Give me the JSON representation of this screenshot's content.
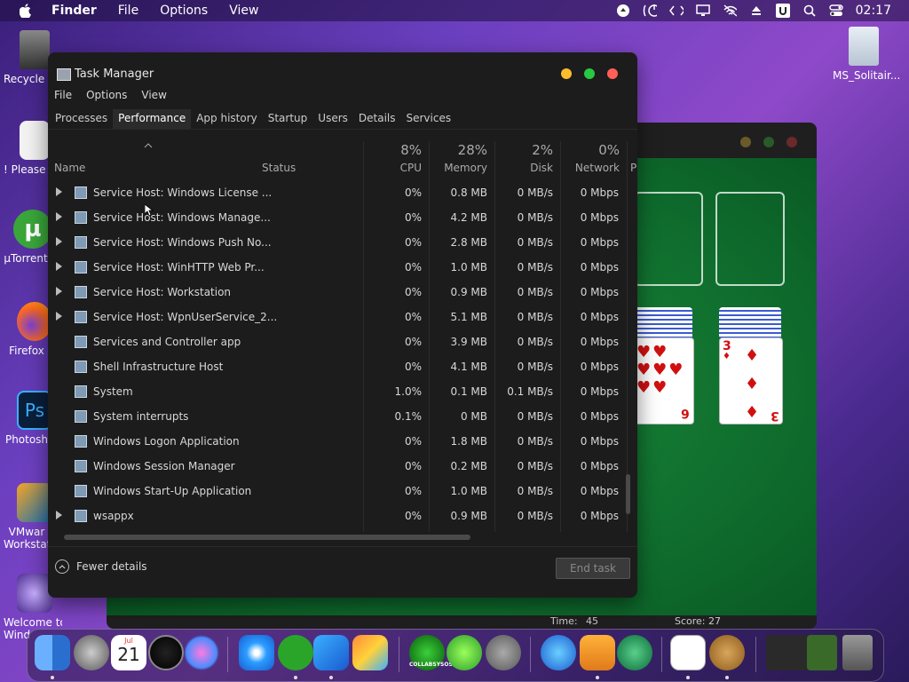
{
  "menubar": {
    "app": "Finder",
    "items": [
      "File",
      "Options",
      "View"
    ],
    "clock": "02:17"
  },
  "desktop": {
    "icons": [
      {
        "label": "Recycle Bin"
      },
      {
        "label": "! Please Re"
      },
      {
        "label": "µTorrent"
      },
      {
        "label": "Firefox"
      },
      {
        "label": "Photosh"
      },
      {
        "label": "VMwar\nWorkstat"
      },
      {
        "label": "Welcome to\nWind"
      }
    ],
    "right_icon": {
      "label": "MS_Solitair..."
    }
  },
  "solitaire": {
    "time_label": "Time:",
    "time_value": "45",
    "score_label": "Score:",
    "score_value": "27",
    "cards": [
      {
        "rank": "6",
        "suit": "♥"
      },
      {
        "rank": "3",
        "suit": "♦"
      }
    ]
  },
  "task_manager": {
    "title": "Task Manager",
    "menu": [
      "File",
      "Options",
      "View"
    ],
    "tabs": [
      "Processes",
      "Performance",
      "App history",
      "Startup",
      "Users",
      "Details",
      "Services"
    ],
    "active_tab": "Performance",
    "columns": {
      "name": "Name",
      "status": "Status",
      "cpu": {
        "pct": "8%",
        "label": "CPU"
      },
      "memory": {
        "pct": "28%",
        "label": "Memory"
      },
      "disk": {
        "pct": "2%",
        "label": "Disk"
      },
      "network": {
        "pct": "0%",
        "label": "Network"
      },
      "next": "P"
    },
    "rows": [
      {
        "name": "Service Host: Windows License ...",
        "cpu": "0%",
        "memory": "0.8 MB",
        "disk": "0 MB/s",
        "network": "0 Mbps",
        "expandable": true
      },
      {
        "name": "Service Host: Windows Manage...",
        "cpu": "0%",
        "memory": "4.2 MB",
        "disk": "0 MB/s",
        "network": "0 Mbps",
        "expandable": true
      },
      {
        "name": "Service Host: Windows Push No...",
        "cpu": "0%",
        "memory": "2.8 MB",
        "disk": "0 MB/s",
        "network": "0 Mbps",
        "expandable": true
      },
      {
        "name": "Service Host: WinHTTP Web Pr...",
        "cpu": "0%",
        "memory": "1.0 MB",
        "disk": "0 MB/s",
        "network": "0 Mbps",
        "expandable": true
      },
      {
        "name": "Service Host: Workstation",
        "cpu": "0%",
        "memory": "0.9 MB",
        "disk": "0 MB/s",
        "network": "0 Mbps",
        "expandable": true
      },
      {
        "name": "Service Host: WpnUserService_2...",
        "cpu": "0%",
        "memory": "5.1 MB",
        "disk": "0 MB/s",
        "network": "0 Mbps",
        "expandable": true
      },
      {
        "name": "Services and Controller app",
        "cpu": "0%",
        "memory": "3.9 MB",
        "disk": "0 MB/s",
        "network": "0 Mbps",
        "expandable": false
      },
      {
        "name": "Shell Infrastructure Host",
        "cpu": "0%",
        "memory": "4.1 MB",
        "disk": "0 MB/s",
        "network": "0 Mbps",
        "expandable": false
      },
      {
        "name": "System",
        "cpu": "1.0%",
        "memory": "0.1 MB",
        "disk": "0.1 MB/s",
        "network": "0 Mbps",
        "expandable": false
      },
      {
        "name": "System interrupts",
        "cpu": "0.1%",
        "memory": "0 MB",
        "disk": "0 MB/s",
        "network": "0 Mbps",
        "expandable": false
      },
      {
        "name": "Windows Logon Application",
        "cpu": "0%",
        "memory": "1.8 MB",
        "disk": "0 MB/s",
        "network": "0 Mbps",
        "expandable": false
      },
      {
        "name": "Windows Session Manager",
        "cpu": "0%",
        "memory": "0.2 MB",
        "disk": "0 MB/s",
        "network": "0 Mbps",
        "expandable": false
      },
      {
        "name": "Windows Start-Up Application",
        "cpu": "0%",
        "memory": "1.0 MB",
        "disk": "0 MB/s",
        "network": "0 Mbps",
        "expandable": false
      },
      {
        "name": "wsappx",
        "cpu": "0%",
        "memory": "0.9 MB",
        "disk": "0 MB/s",
        "network": "0 Mbps",
        "expandable": true
      }
    ],
    "fewer_details": "Fewer details",
    "end_task": "End task"
  },
  "dock": {
    "calendar_month": "Jul",
    "calendar_day": "21",
    "collabsysos": "COLLABSYSOS"
  },
  "colors": {
    "close": "#ff5f57",
    "minimize": "#febc2e",
    "maximize": "#28c840",
    "felt": "#0e6a2c"
  }
}
